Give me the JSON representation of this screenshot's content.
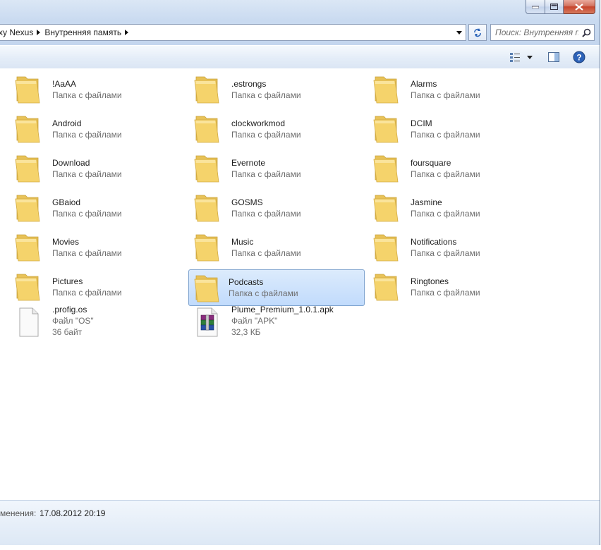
{
  "window": {
    "caption_buttons": [
      "minimize",
      "maximize",
      "close"
    ]
  },
  "address": {
    "breadcrumbs": [
      "xy Nexus",
      "Внутренняя память"
    ],
    "search_placeholder": "Поиск: Внутренняя память"
  },
  "toolbar": {
    "view_icon": "view-options-icon",
    "preview_icon": "preview-pane-icon",
    "help_icon": "help-icon"
  },
  "items": [
    {
      "name": "!AaAA",
      "sub": "Папка с файлами",
      "kind": "folder"
    },
    {
      "name": ".estrongs",
      "sub": "Папка с файлами",
      "kind": "folder"
    },
    {
      "name": "Alarms",
      "sub": "Папка с файлами",
      "kind": "folder"
    },
    {
      "name": "Android",
      "sub": "Папка с файлами",
      "kind": "folder"
    },
    {
      "name": "clockworkmod",
      "sub": "Папка с файлами",
      "kind": "folder"
    },
    {
      "name": "DCIM",
      "sub": "Папка с файлами",
      "kind": "folder"
    },
    {
      "name": "Download",
      "sub": "Папка с файлами",
      "kind": "folder"
    },
    {
      "name": "Evernote",
      "sub": "Папка с файлами",
      "kind": "folder"
    },
    {
      "name": "foursquare",
      "sub": "Папка с файлами",
      "kind": "folder"
    },
    {
      "name": "GBaiod",
      "sub": "Папка с файлами",
      "kind": "folder"
    },
    {
      "name": "GOSMS",
      "sub": "Папка с файлами",
      "kind": "folder"
    },
    {
      "name": "Jasmine",
      "sub": "Папка с файлами",
      "kind": "folder"
    },
    {
      "name": "Movies",
      "sub": "Папка с файлами",
      "kind": "folder"
    },
    {
      "name": "Music",
      "sub": "Папка с файлами",
      "kind": "folder"
    },
    {
      "name": "Notifications",
      "sub": "Папка с файлами",
      "kind": "folder"
    },
    {
      "name": "Pictures",
      "sub": "Папка с файлами",
      "kind": "folder"
    },
    {
      "name": "Podcasts",
      "sub": "Папка с файлами",
      "kind": "folder",
      "selected": true
    },
    {
      "name": "Ringtones",
      "sub": "Папка с файлами",
      "kind": "folder"
    },
    {
      "name": ".profig.os",
      "sub": "Файл \"OS\"",
      "size": "36 байт",
      "kind": "file"
    },
    {
      "name": "Plume_Premium_1.0.1.apk",
      "sub": "Файл \"APK\"",
      "size": "32,3 КБ",
      "kind": "archive"
    }
  ],
  "details": {
    "label": "менения:",
    "value": "17.08.2012 20:19"
  },
  "colors": {
    "selection": "#c9e0fc",
    "folder": "#f5d36b"
  }
}
